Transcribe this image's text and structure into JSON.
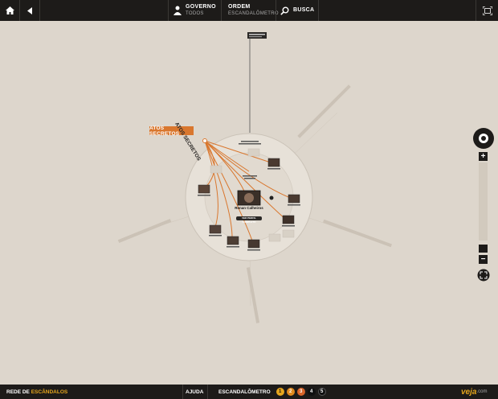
{
  "topbar": {
    "home_icon": "home-icon",
    "back_icon": "back-arrow-icon",
    "governo": {
      "title": "GOVERNO",
      "subtitle": "TODOS"
    },
    "ordem": {
      "title": "ORDEM",
      "subtitle": "ESCANDALÔMETRO"
    },
    "busca": {
      "label": "BUSCA"
    },
    "fullscreen_icon": "fullscreen-icon"
  },
  "map": {
    "highlight_label": "ATOS SECRETOS",
    "rotated_label": "ATOS SECRETOS",
    "central_person": "Renan Calheiros",
    "central_button": "VER PERFIL COMPLETO",
    "colors": {
      "accent": "#d9772e",
      "background": "#ddd6cc",
      "bar": "#1d1b19"
    }
  },
  "bottombar": {
    "brand_prefix": "REDE DE ",
    "brand_highlight": "ESCÂNDALOS",
    "ajuda": "AJUDA",
    "escandalometro": "ESCANDALÔMETRO",
    "levels": [
      "1",
      "2",
      "3",
      "4",
      "5"
    ],
    "level_colors": [
      "#e6a61e",
      "#e08a1e",
      "#d9662a",
      "#111111",
      "#111111"
    ],
    "logo": "veja",
    "logo_suffix": ".com"
  }
}
